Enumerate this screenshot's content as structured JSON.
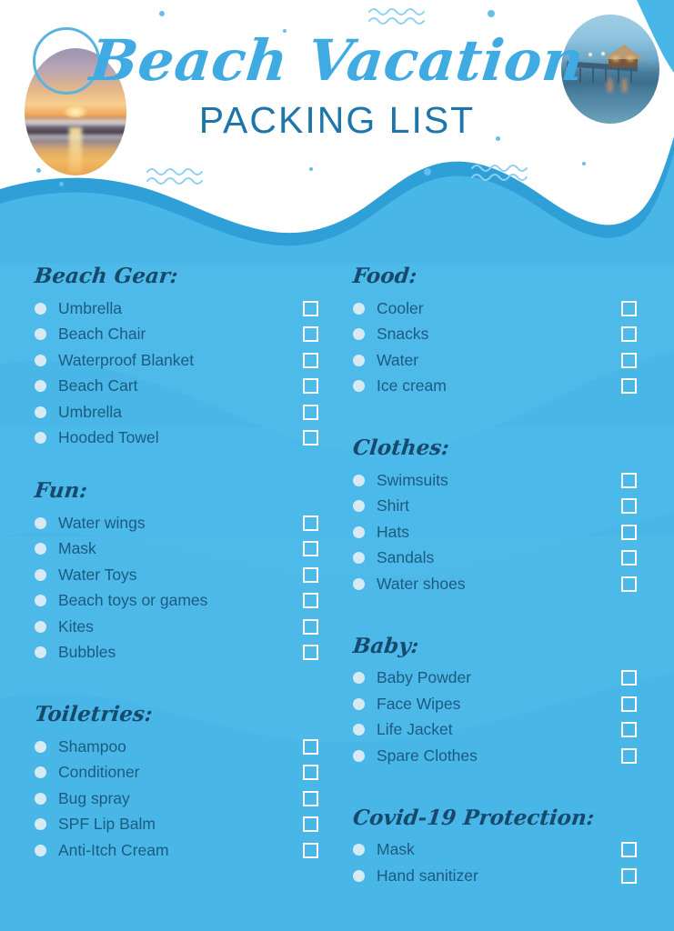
{
  "header": {
    "title_script": "Beach Vacation",
    "title_sub": "PACKING LIST",
    "photo_left_alt": "sunset-beach-photo",
    "photo_right_alt": "pier-hut-dusk-photo"
  },
  "colors": {
    "page_background": "#48b7e8",
    "header_background": "#ffffff",
    "wave_edge": "#2f9fd8",
    "wave_body": "#48b7e8",
    "title_script": "#3fabe2",
    "title_sub": "#1d76a7",
    "group_title": "#16496b",
    "item_text": "#1d5a80",
    "bullet": "#e3eef4",
    "checkbox_border": "#ffffff",
    "squiggle": "#8fd0f0",
    "dot": "#63bfeb"
  },
  "left_column": [
    {
      "title": "Beach Gear:",
      "items": [
        "Umbrella",
        "Beach Chair",
        "Waterproof Blanket",
        "Beach Cart",
        "Umbrella",
        "Hooded Towel"
      ]
    },
    {
      "title": "Fun:",
      "items": [
        "Water wings",
        "Mask",
        "Water Toys",
        "Beach toys or games",
        "Kites",
        "Bubbles"
      ]
    },
    {
      "title": "Toiletries:",
      "items": [
        "Shampoo",
        "Conditioner",
        "Bug spray",
        "SPF Lip Balm",
        "Anti-Itch Cream"
      ]
    }
  ],
  "right_column": [
    {
      "title": "Food:",
      "items": [
        "Cooler",
        "Snacks",
        "Water",
        "Ice cream"
      ]
    },
    {
      "title": "Clothes:",
      "items": [
        "Swimsuits",
        "Shirt",
        "Hats",
        "Sandals",
        "Water shoes"
      ]
    },
    {
      "title": "Baby:",
      "items": [
        "Baby Powder",
        "Face Wipes",
        "Life Jacket",
        "Spare Clothes"
      ]
    },
    {
      "title": "Covid-19 Protection:",
      "items": [
        "Mask",
        "Hand sanitizer"
      ]
    }
  ]
}
